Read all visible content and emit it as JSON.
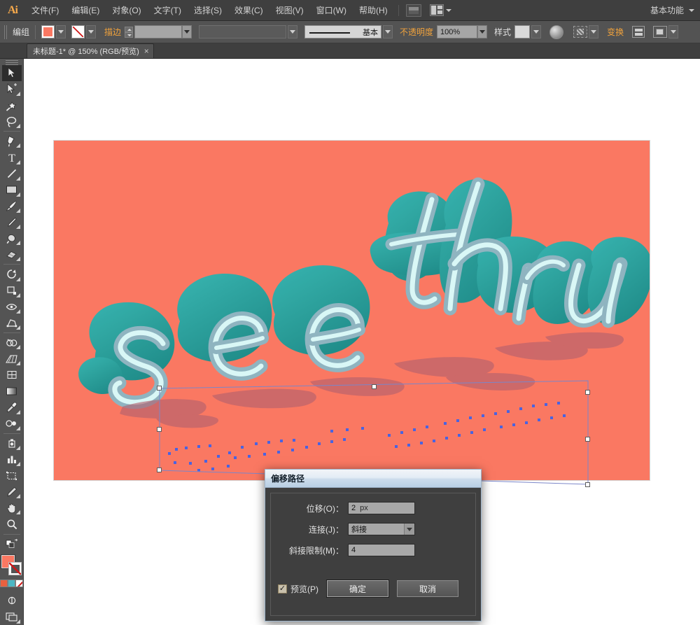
{
  "app": {
    "logo": "Ai",
    "workspace": "基本功能"
  },
  "menu": {
    "items": [
      {
        "label": "文件(F)"
      },
      {
        "label": "编辑(E)"
      },
      {
        "label": "对象(O)"
      },
      {
        "label": "文字(T)"
      },
      {
        "label": "选择(S)"
      },
      {
        "label": "效果(C)"
      },
      {
        "label": "视图(V)"
      },
      {
        "label": "窗口(W)"
      },
      {
        "label": "帮助(H)"
      }
    ]
  },
  "control_bar": {
    "selection_label": "编组",
    "fill_color": "#fa7862",
    "stroke_value": "无",
    "stroke_label": "描边",
    "stroke_weight": "",
    "stroke_profile": "",
    "brush_definition": "基本",
    "opacity_label": "不透明度",
    "opacity_value": "100%",
    "style_label": "样式",
    "transform_label": "变换"
  },
  "document_tab": {
    "title": "未标题-1* @ 150% (RGB/预览)",
    "close": "×"
  },
  "toolbar": {
    "tools": [
      {
        "name": "selection-tool",
        "active": true
      },
      {
        "name": "direct-selection-tool",
        "active": false
      },
      {
        "name": "magic-wand-tool",
        "active": false
      },
      {
        "name": "lasso-tool",
        "active": false
      },
      {
        "name": "pen-tool",
        "active": false
      },
      {
        "name": "type-tool",
        "active": false
      },
      {
        "name": "line-segment-tool",
        "active": false
      },
      {
        "name": "rectangle-tool",
        "active": false
      },
      {
        "name": "paintbrush-tool",
        "active": false
      },
      {
        "name": "pencil-tool",
        "active": false
      },
      {
        "name": "blob-brush-tool",
        "active": false
      },
      {
        "name": "eraser-tool",
        "active": false
      },
      {
        "name": "rotate-tool",
        "active": false
      },
      {
        "name": "scale-tool",
        "active": false
      },
      {
        "name": "width-tool",
        "active": false
      },
      {
        "name": "free-transform-tool",
        "active": false
      },
      {
        "name": "shape-builder-tool",
        "active": false
      },
      {
        "name": "perspective-grid-tool",
        "active": false
      },
      {
        "name": "mesh-tool",
        "active": false
      },
      {
        "name": "gradient-tool",
        "active": false
      },
      {
        "name": "eyedropper-tool",
        "active": false
      },
      {
        "name": "blend-tool",
        "active": false
      },
      {
        "name": "symbol-sprayer-tool",
        "active": false
      },
      {
        "name": "column-graph-tool",
        "active": false
      },
      {
        "name": "artboard-tool",
        "active": false
      },
      {
        "name": "slice-tool",
        "active": false
      },
      {
        "name": "hand-tool",
        "active": false
      },
      {
        "name": "zoom-tool",
        "active": false
      }
    ],
    "fill_color": "#fa7862",
    "stroke_color": "none",
    "color_modes": [
      "#e8613f",
      "#4cb7c4",
      "#ffffff"
    ]
  },
  "artwork": {
    "background_color": "#fa7862",
    "text": "see thru",
    "face_color": "#2fb3ae",
    "extrude_color": "#1c8e8b",
    "outline_color": "#c8f2f2",
    "shadow_color": "#b36a74",
    "anchor_color": "#4a63e0",
    "selection_box_color": "#7b86c9"
  },
  "dialog": {
    "title": "偏移路径",
    "fields": [
      {
        "label": "位移(O)：",
        "value": "2",
        "unit": "px",
        "type": "input"
      },
      {
        "label": "连接(J)：",
        "value": "斜接",
        "type": "select"
      },
      {
        "label": "斜接限制(M)：",
        "value": "4",
        "type": "input"
      }
    ],
    "preview_label": "预览(P)",
    "preview_checked": "✓",
    "ok_label": "确定",
    "cancel_label": "取消"
  }
}
